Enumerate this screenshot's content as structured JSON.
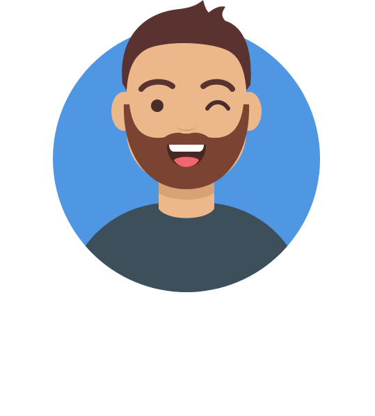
{
  "avatar": {
    "icon": "winking-bearded-man-avatar-icon",
    "colors": {
      "background_circle": "#4f96e3",
      "skin": "#ecb88a",
      "skin_shadow": "#d9a274",
      "hair": "#5a3330",
      "beard": "#7b4331",
      "shirt": "#3d4f5b",
      "eye": "#4a2e2a",
      "mouth": "#4a2622",
      "teeth": "#ffffff",
      "tongue": "#f06773",
      "page_background": "#ffffff"
    }
  }
}
